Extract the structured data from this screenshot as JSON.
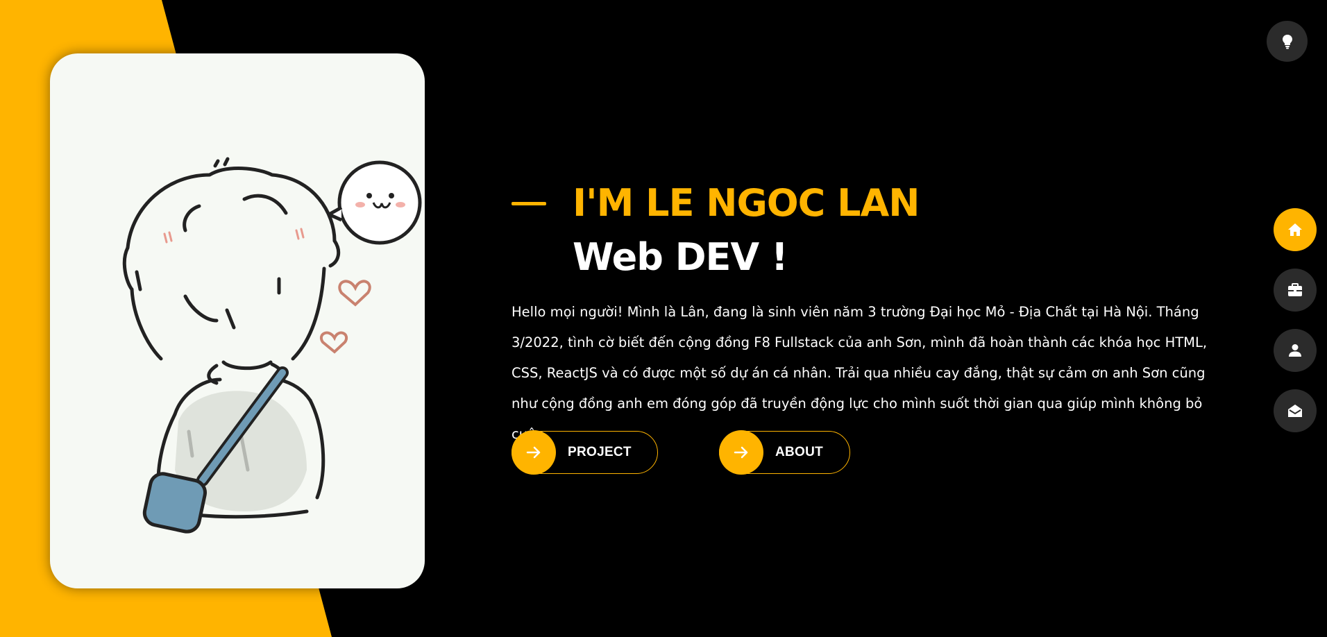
{
  "hero": {
    "name": "I'M LE NGOC LAN",
    "role": "Web DEV !",
    "description": "Hello mọi người! Mình là Lân, đang là sinh viên năm 3 trường Đại học Mỏ - Địa Chất tại Hà Nội. Tháng 3/2022, tình cờ biết đến cộng đồng F8 Fullstack của anh Sơn, mình đã hoàn thành các khóa học HTML, CSS, ReactJS và có được một số dự án cá nhân. Trải qua nhiều cay đắng, thật sự cảm ơn anh Sơn cũng như cộng đồng anh em đóng góp đã truyền động lực cho mình suốt thời gian qua giúp mình không bỏ cuộc."
  },
  "buttons": {
    "project_label": "PROJECT",
    "about_label": "ABOUT",
    "icon": "arrow-right-icon"
  },
  "theme_toggle": {
    "icon": "lightbulb-icon"
  },
  "side_nav": [
    {
      "icon": "home-icon",
      "active": true
    },
    {
      "icon": "briefcase-icon",
      "active": false
    },
    {
      "icon": "user-icon",
      "active": false
    },
    {
      "icon": "envelope-open-icon",
      "active": false
    }
  ],
  "colors": {
    "accent": "#ffb400",
    "background": "#000000",
    "icon_bg": "#2b2b2b",
    "text": "#ffffff"
  }
}
